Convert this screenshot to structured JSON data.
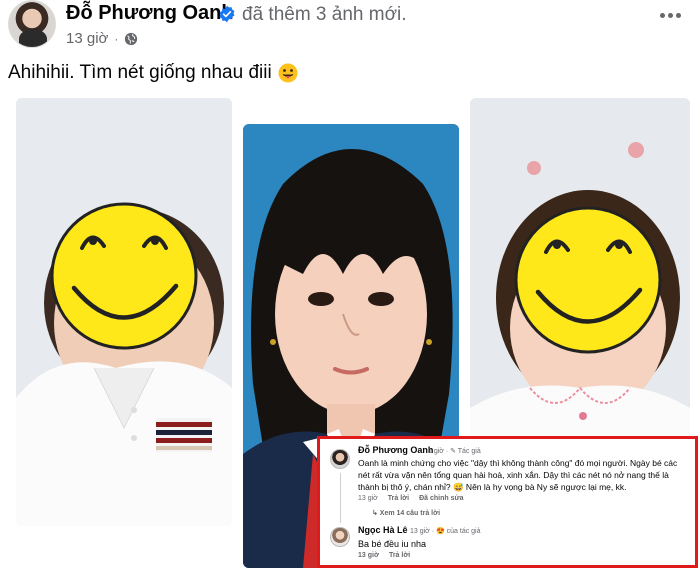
{
  "post": {
    "author": "Đỗ Phương Oanh",
    "action": "đã thêm 3 ảnh mới.",
    "time": "13 giờ",
    "separator": "·",
    "caption": "Ahihihii. Tìm nét giống nhau điii",
    "caption_emoji": "tongue-out-face-icon",
    "audience_icon": "globe-icon",
    "menu_icon": "more-options-icon",
    "verified_color": "#1877f2"
  },
  "photos": [
    {
      "subject": "toddler in white polo shirt, face covered by smiley",
      "bg": "#e7eaee"
    },
    {
      "subject": "girl with bangs, school photo on blue background",
      "bg": "#2c86bf"
    },
    {
      "subject": "little girl with pink hair clip, face covered by smiley",
      "bg": "#e6e9ed"
    }
  ],
  "comments": [
    {
      "name": "Đỗ Phương Oanh",
      "tag": "1 giờ · ✎ Tác giả",
      "lines": [
        "Oanh là minh chứng cho việc \"dậy thì không thành công\" đó mọi người. Ngày bé các",
        "nét rất vừa vặn nên tổng quan hài hoà, xinh xắn. Dậy thì các nét nó nở nang thế là",
        "thành bị thô ý, chán nhỉ? 😅 Nên là hy vọng bà Ny sẽ ngược lại mẹ, kk."
      ],
      "actions": [
        "13 giờ",
        "Trả lời",
        "Đã chỉnh sửa"
      ],
      "replies_link": "↳ Xem 14 câu trả lời"
    },
    {
      "name": "Ngọc Hà Lê",
      "tag": "13 giờ · 😍 của tác giả",
      "text": "Ba bé đều iu nha",
      "actions": [
        "13 giờ",
        "Trả lời"
      ]
    }
  ],
  "highlight_color": "#e01a1a"
}
